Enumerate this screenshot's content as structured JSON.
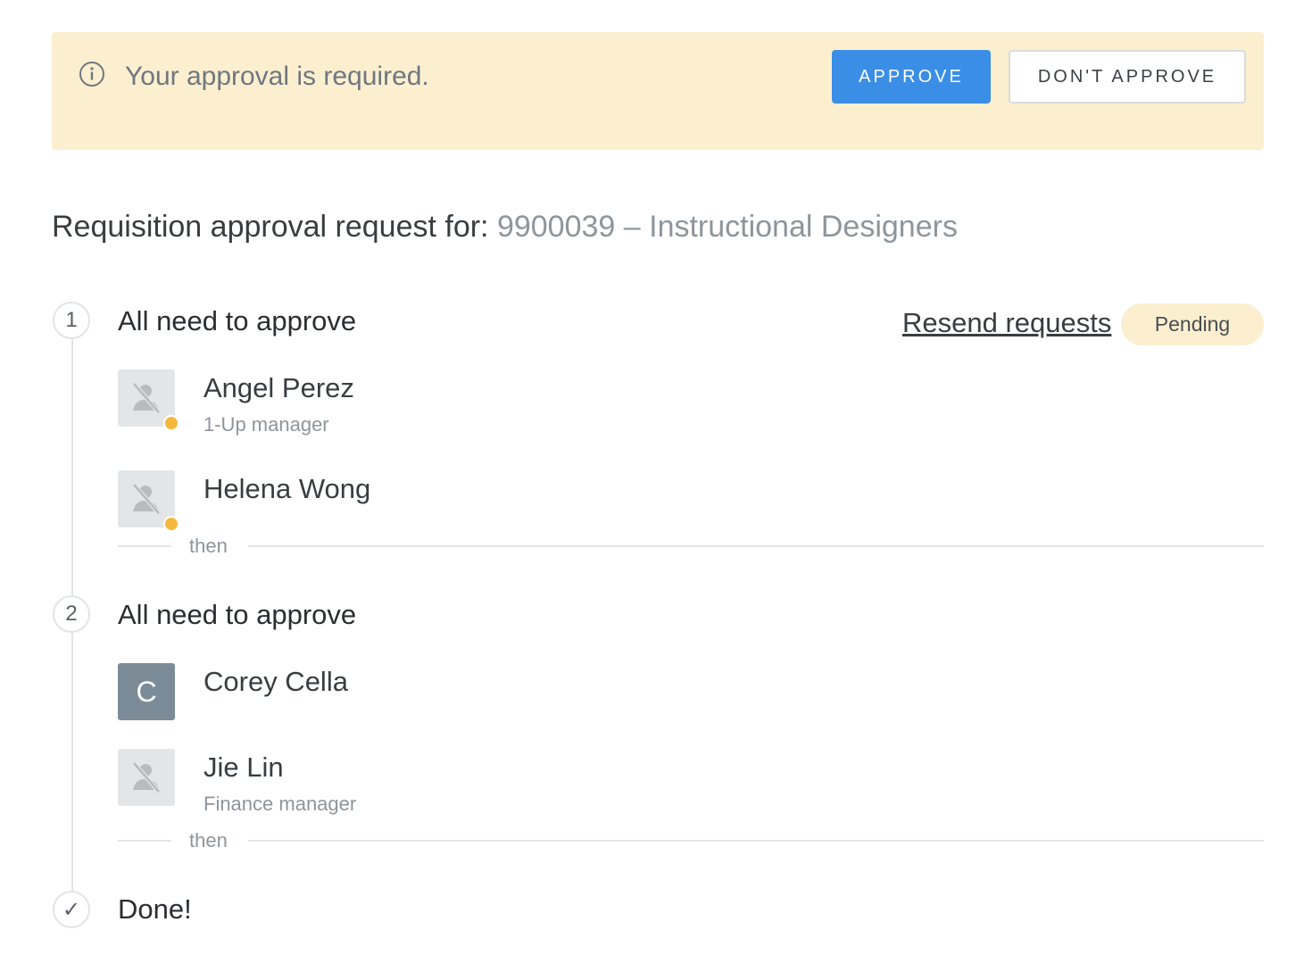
{
  "banner": {
    "message": "Your approval is required.",
    "approve_label": "APPROVE",
    "dont_approve_label": "DON'T APPROVE",
    "icon": "info-icon",
    "background": "#fcefcf"
  },
  "heading": {
    "prefix": "Requisition approval request for:",
    "requisition": "9900039 – Instructional Designers"
  },
  "steps": [
    {
      "number": "1",
      "title": "All need to approve",
      "resend_label": "Resend requests",
      "status": "Pending",
      "approvers": [
        {
          "name": "Angel Perez",
          "role": "1-Up manager",
          "avatar": "no-photo-icon",
          "status_dot": "pending"
        },
        {
          "name": "Helena Wong",
          "role": "",
          "avatar": "no-photo-icon",
          "status_dot": "pending"
        }
      ],
      "separator": "then"
    },
    {
      "number": "2",
      "title": "All need to approve",
      "approvers": [
        {
          "name": "Corey Cella",
          "role": "",
          "avatar_letter": "C"
        },
        {
          "name": "Jie Lin",
          "role": "Finance manager",
          "avatar": "no-photo-icon"
        }
      ],
      "separator": "then"
    }
  ],
  "done": {
    "marker": "✓",
    "label": "Done!"
  },
  "colors": {
    "primary": "#3a8ee6",
    "pending": "#f5b83d",
    "avatar_letter_bg": "#7b8b97"
  }
}
